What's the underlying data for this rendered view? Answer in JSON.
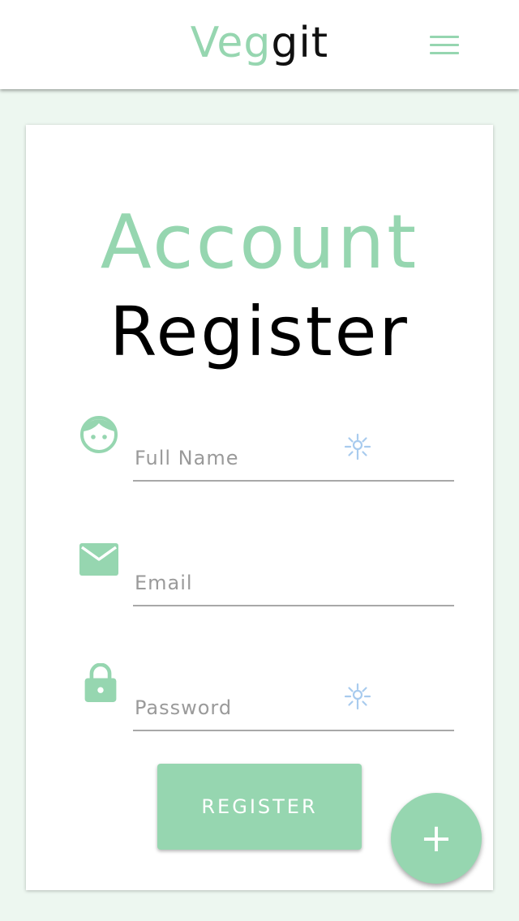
{
  "header": {
    "logo_part1": "Veg",
    "logo_part2": "git",
    "menu_icon": "hamburger-menu-icon"
  },
  "form": {
    "title_line1": "Account",
    "title_line2": "Register",
    "fields": [
      {
        "icon": "face-icon",
        "placeholder": "Full Name",
        "value": "",
        "autofill_icon": "autofill-key-icon"
      },
      {
        "icon": "envelope-icon",
        "placeholder": "Email",
        "value": ""
      },
      {
        "icon": "lock-icon",
        "placeholder": "Password",
        "value": "",
        "autofill_icon": "autofill-key-icon"
      }
    ],
    "submit_label": "REGISTER"
  },
  "fab": {
    "icon": "plus-icon",
    "label": "+"
  },
  "colors": {
    "accent": "#96d6b0",
    "background": "#edf7f0",
    "card": "#ffffff",
    "text_dark": "#000000",
    "placeholder": "#9a9a9a",
    "autofill_icon": "#a8cbee"
  }
}
